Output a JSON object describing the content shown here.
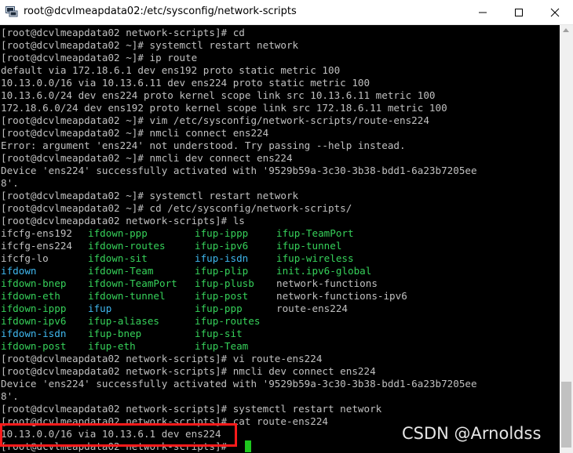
{
  "window": {
    "title": "root@dcvlmeapdata02:/etc/sysconfig/network-scripts",
    "icon": "putty-icon",
    "controls": [
      "minimize-icon",
      "maximize-icon",
      "close-icon"
    ]
  },
  "colors": {
    "background": "#000000",
    "text": "#c0c0c0",
    "executable": "#36d15a",
    "symlink": "#3fb7ee",
    "cursor": "#1ec71e",
    "highlight_box": "#ff1b1b"
  },
  "terminal": {
    "lines_top": [
      "[root@dcvlmeapdata02 network-scripts]# cd",
      "[root@dcvlmeapdata02 ~]# systemctl restart network",
      "[root@dcvlmeapdata02 ~]# ip route",
      "default via 172.18.6.1 dev ens192 proto static metric 100",
      "10.13.0.0/16 via 10.13.6.11 dev ens224 proto static metric 100",
      "10.13.6.0/24 dev ens224 proto kernel scope link src 10.13.6.11 metric 100",
      "172.18.6.0/24 dev ens192 proto kernel scope link src 172.18.6.11 metric 100",
      "[root@dcvlmeapdata02 ~]# vim /etc/sysconfig/network-scripts/route-ens224",
      "[root@dcvlmeapdata02 ~]# nmcli connect ens224",
      "Error: argument 'ens224' not understood. Try passing --help instead.",
      "[root@dcvlmeapdata02 ~]# nmcli dev connect ens224",
      "Device 'ens224' successfully activated with '9529b59a-3c30-3b38-bdd1-6a23b7205ee",
      "8'.",
      "[root@dcvlmeapdata02 ~]# systemctl restart network",
      "[root@dcvlmeapdata02 ~]# cd /etc/sysconfig/network-scripts/",
      "[root@dcvlmeapdata02 network-scripts]# ls"
    ],
    "ls_rows": [
      [
        {
          "name": "ifcfg-ens192",
          "color": "plain"
        },
        {
          "name": "ifdown-ppp",
          "color": "green"
        },
        {
          "name": "ifup-ippp",
          "color": "green"
        },
        {
          "name": "ifup-TeamPort",
          "color": "green"
        }
      ],
      [
        {
          "name": "ifcfg-ens224",
          "color": "plain"
        },
        {
          "name": "ifdown-routes",
          "color": "green"
        },
        {
          "name": "ifup-ipv6",
          "color": "green"
        },
        {
          "name": "ifup-tunnel",
          "color": "green"
        }
      ],
      [
        {
          "name": "ifcfg-lo",
          "color": "plain"
        },
        {
          "name": "ifdown-sit",
          "color": "green"
        },
        {
          "name": "ifup-isdn",
          "color": "cyan"
        },
        {
          "name": "ifup-wireless",
          "color": "green"
        }
      ],
      [
        {
          "name": "ifdown",
          "color": "cyan"
        },
        {
          "name": "ifdown-Team",
          "color": "green"
        },
        {
          "name": "ifup-plip",
          "color": "green"
        },
        {
          "name": "init.ipv6-global",
          "color": "green"
        }
      ],
      [
        {
          "name": "ifdown-bnep",
          "color": "green"
        },
        {
          "name": "ifdown-TeamPort",
          "color": "green"
        },
        {
          "name": "ifup-plusb",
          "color": "green"
        },
        {
          "name": "network-functions",
          "color": "plain"
        }
      ],
      [
        {
          "name": "ifdown-eth",
          "color": "green"
        },
        {
          "name": "ifdown-tunnel",
          "color": "green"
        },
        {
          "name": "ifup-post",
          "color": "green"
        },
        {
          "name": "network-functions-ipv6",
          "color": "plain"
        }
      ],
      [
        {
          "name": "ifdown-ippp",
          "color": "green"
        },
        {
          "name": "ifup",
          "color": "cyan"
        },
        {
          "name": "ifup-ppp",
          "color": "green"
        },
        {
          "name": "route-ens224",
          "color": "plain"
        }
      ],
      [
        {
          "name": "ifdown-ipv6",
          "color": "green"
        },
        {
          "name": "ifup-aliases",
          "color": "green"
        },
        {
          "name": "ifup-routes",
          "color": "green"
        },
        {
          "name": "",
          "color": "plain"
        }
      ],
      [
        {
          "name": "ifdown-isdn",
          "color": "cyan"
        },
        {
          "name": "ifup-bnep",
          "color": "green"
        },
        {
          "name": "ifup-sit",
          "color": "green"
        },
        {
          "name": "",
          "color": "plain"
        }
      ],
      [
        {
          "name": "ifdown-post",
          "color": "green"
        },
        {
          "name": "ifup-eth",
          "color": "green"
        },
        {
          "name": "ifup-Team",
          "color": "green"
        },
        {
          "name": "",
          "color": "plain"
        }
      ]
    ],
    "lines_bottom": [
      "[root@dcvlmeapdata02 network-scripts]# vi route-ens224",
      "[root@dcvlmeapdata02 network-scripts]# nmcli dev connect ens224",
      "Device 'ens224' successfully activated with '9529b59a-3c30-3b38-bdd1-6a23b7205ee",
      "8'.",
      "[root@dcvlmeapdata02 network-scripts]# systemctl restart network",
      "[root@dcvlmeapdata02 network-scripts]# cat route-ens224",
      "10.13.0.0/16 via 10.13.6.1 dev ens224",
      "[root@dcvlmeapdata02 network-scripts]# "
    ]
  },
  "watermark": "CSDN @Arnoldss"
}
